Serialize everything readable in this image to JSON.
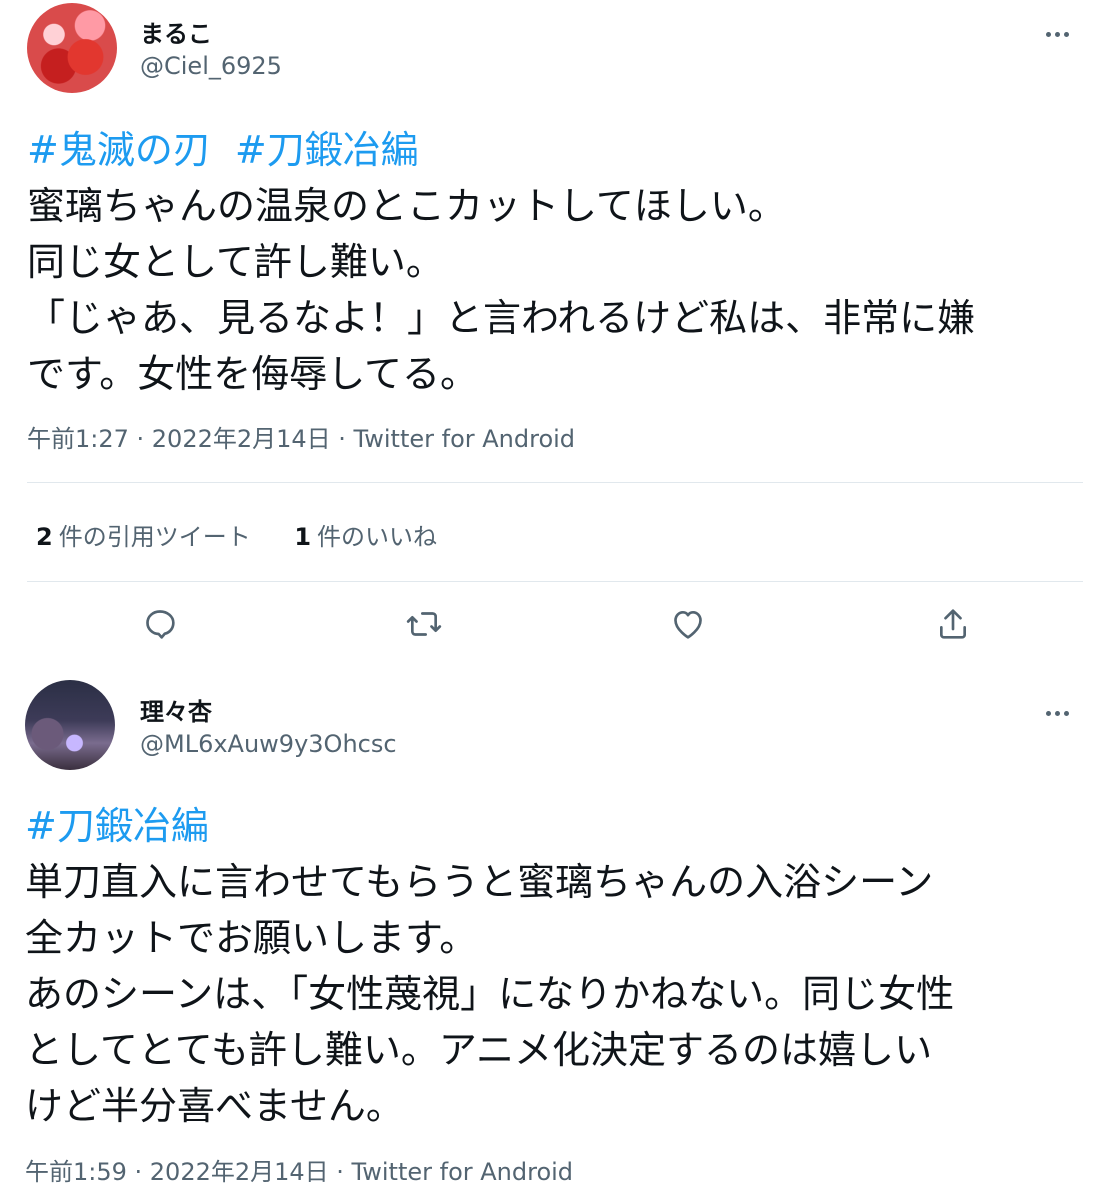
{
  "tweets": [
    {
      "display_name": "まるこ",
      "handle": "@Ciel_6925",
      "hashtags": [
        "#鬼滅の刃",
        "#刀鍛冶編"
      ],
      "text": "蜜璃ちゃんの温泉のとこカットしてほしい。\n同じ女として許し難い。\n「じゃあ、見るなよ！」と言われるけど私は、非常に嫌\nです。女性を侮辱してる。",
      "timestamp": "午前1:27 · 2022年2月14日 · Twitter for Android",
      "quote_count": "2",
      "quote_label": "件の引用ツイート",
      "like_count": "1",
      "like_label": "件のいいね"
    },
    {
      "display_name": "理々杏",
      "handle": "@ML6xAuw9y3Ohcsc",
      "hashtags": [
        "#刀鍛冶編"
      ],
      "text": "単刀直入に言わせてもらうと蜜璃ちゃんの入浴シーン\n全カットでお願いします。\nあのシーンは、「女性蔑視」になりかねない。同じ女性\nとしてとても許し難い。アニメ化決定するのは嬉しい\nけど半分喜べません。",
      "timestamp": "午前1:59 · 2022年2月14日 · Twitter for Android"
    }
  ],
  "icons": {
    "reply": "reply-icon",
    "retweet": "retweet-icon",
    "like": "heart-icon",
    "share": "share-icon",
    "more": "more-icon"
  },
  "colors": {
    "hashtag": "#1d9bf0",
    "secondary_text": "#536471",
    "primary_text": "#0f1419"
  }
}
